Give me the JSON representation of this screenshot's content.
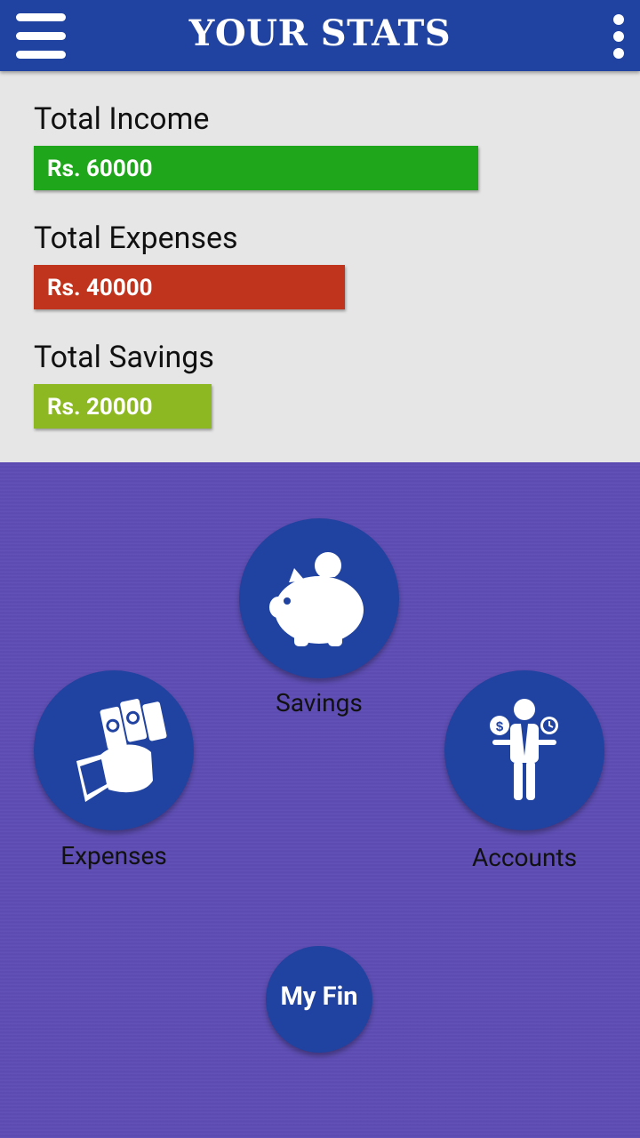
{
  "header": {
    "title": "YOUR STATS",
    "bar_color": "#2042a0",
    "menu_icon": "hamburger-menu-icon",
    "more_icon": "more-vertical-icon"
  },
  "stats": [
    {
      "label": "Total Income",
      "amount": "Rs. 60000",
      "value": 60000,
      "color": "#1fa61a"
    },
    {
      "label": "Total Expenses",
      "amount": "Rs. 40000",
      "value": 40000,
      "color": "#c0341d"
    },
    {
      "label": "Total Savings",
      "amount": "Rs. 20000",
      "value": 20000,
      "color": "#8db822"
    }
  ],
  "nav": {
    "savings": {
      "label": "Savings",
      "icon": "piggy-bank-icon"
    },
    "expenses": {
      "label": "Expenses",
      "icon": "hand-with-money-icon"
    },
    "accounts": {
      "label": "Accounts",
      "icon": "businessman-balancing-money-time-icon"
    },
    "myfin": {
      "label": "My Fin"
    }
  },
  "colors": {
    "background_purple": "#5e4db4",
    "circle_blue": "#2042a0"
  }
}
